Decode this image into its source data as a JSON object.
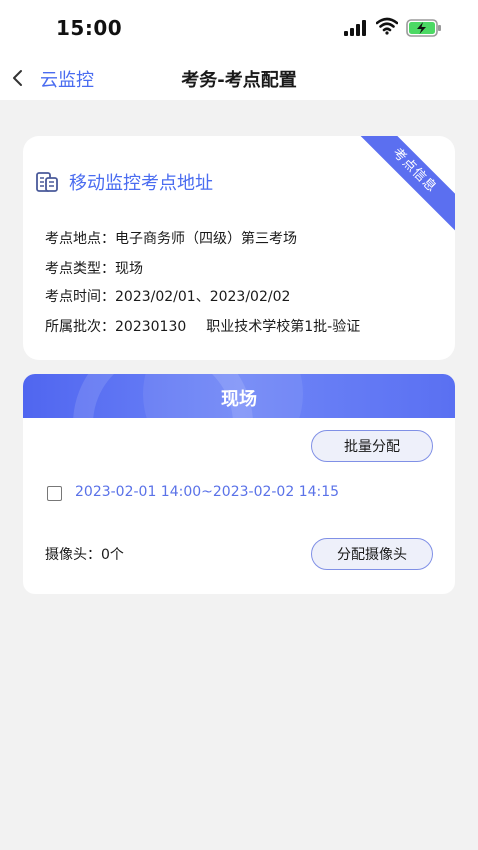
{
  "status_bar": {
    "time": "15:00"
  },
  "nav": {
    "back_label": "云监控",
    "title": "考务-考点配置"
  },
  "info_card": {
    "ribbon": "考点信息",
    "header": "移动监控考点地址",
    "rows": [
      {
        "label": "考点地点：",
        "value": "电子商务师（四级）第三考场"
      },
      {
        "label": "考点类型：",
        "value": "现场"
      },
      {
        "label": "考点时间：",
        "value": "2023/02/01、2023/02/02"
      },
      {
        "label": "所属批次：",
        "value": "20230130",
        "extra": "职业技术学校第1批-验证"
      }
    ]
  },
  "session_card": {
    "title": "现场",
    "batch_button": "批量分配",
    "time_range": "2023-02-01 14:00~2023-02-02 14:15",
    "camera_label": "摄像头：",
    "camera_count": "0个",
    "assign_button": "分配摄像头"
  },
  "colors": {
    "accent": "#4a6cf0",
    "ribbon": "#5b6ff0",
    "header_gradient_start": "#5066f0"
  }
}
